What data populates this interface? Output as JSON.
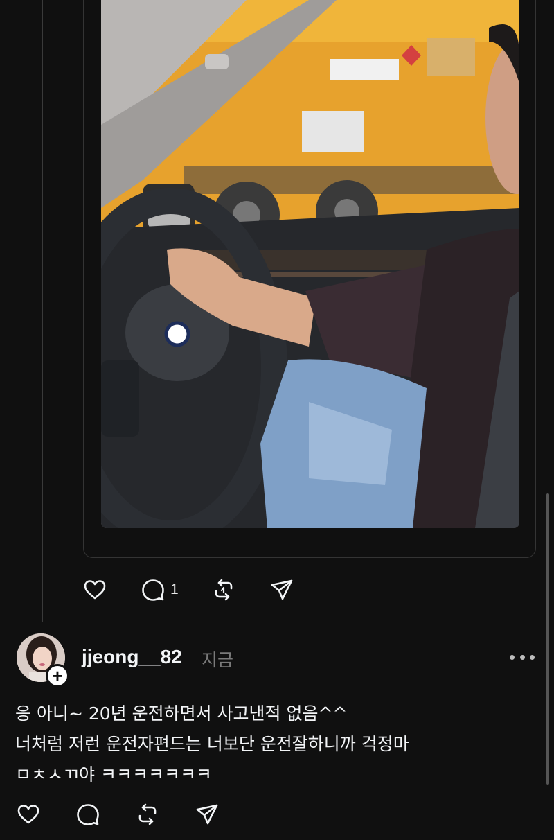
{
  "post": {
    "actions": {
      "like_icon": "heart-icon",
      "comment_icon": "comment-icon",
      "comment_count": "1",
      "repost_icon": "repost-icon",
      "share_icon": "send-icon"
    }
  },
  "reply": {
    "username": "jjeong__82",
    "timestamp": "지금",
    "follow_icon": "plus-icon",
    "more_icon": "more-icon",
    "lines": [
      "응 아니~ 20년 운전하면서 사고낸적 없음^^",
      "너처럼 저런 운전자편드는 너보단 운전잘하니까 걱정마",
      "ㅁㅊㅅㄲ야 ㅋㅋㅋㅋㅋㅋㅋ"
    ],
    "actions": {
      "like_icon": "heart-icon",
      "comment_icon": "comment-icon",
      "repost_icon": "repost-icon",
      "share_icon": "send-icon"
    }
  },
  "colors": {
    "background": "#101010",
    "text": "#f3f5f7",
    "muted": "#7a7a7a"
  }
}
